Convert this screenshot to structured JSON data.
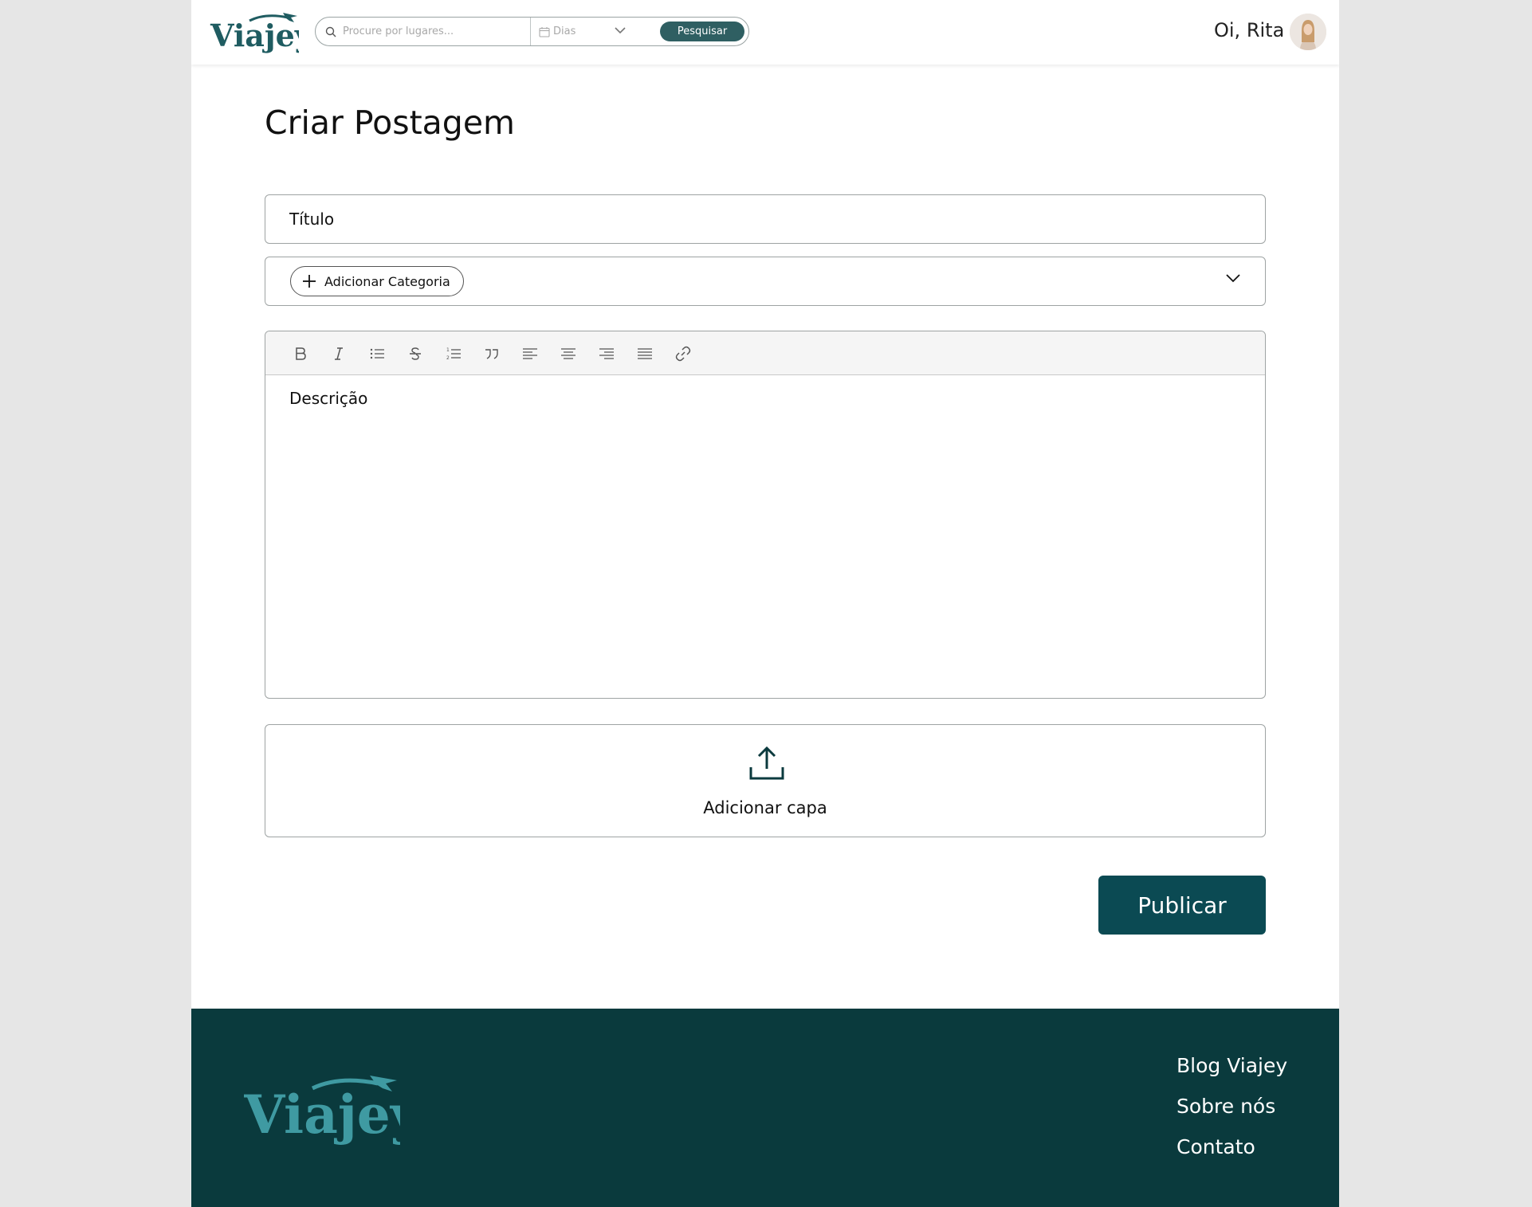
{
  "brand": {
    "name": "Viajey",
    "header_color": "#1f5c61",
    "footer_color": "#3f9aa2",
    "primary": "#0b4a53",
    "footer_bg": "#0a3a3d"
  },
  "header": {
    "search_placeholder": "Procure por lugares...",
    "days_label": "Dias",
    "search_button": "Pesquisar",
    "greeting": "Oi, Rita"
  },
  "main": {
    "title": "Criar Postagem",
    "title_placeholder": "Título",
    "add_category": "Adicionar Categoria",
    "toolbar": [
      "bold-icon",
      "italic-icon",
      "bullet-list-icon",
      "strikethrough-icon",
      "numbered-list-icon",
      "quote-icon",
      "align-left-icon",
      "align-center-icon",
      "align-right-icon",
      "align-justify-icon",
      "link-icon"
    ],
    "description_placeholder": "Descrição",
    "add_cover": "Adicionar capa",
    "publish": "Publicar"
  },
  "footer": {
    "links": [
      "Blog Viajey",
      "Sobre nós",
      "Contato"
    ]
  }
}
